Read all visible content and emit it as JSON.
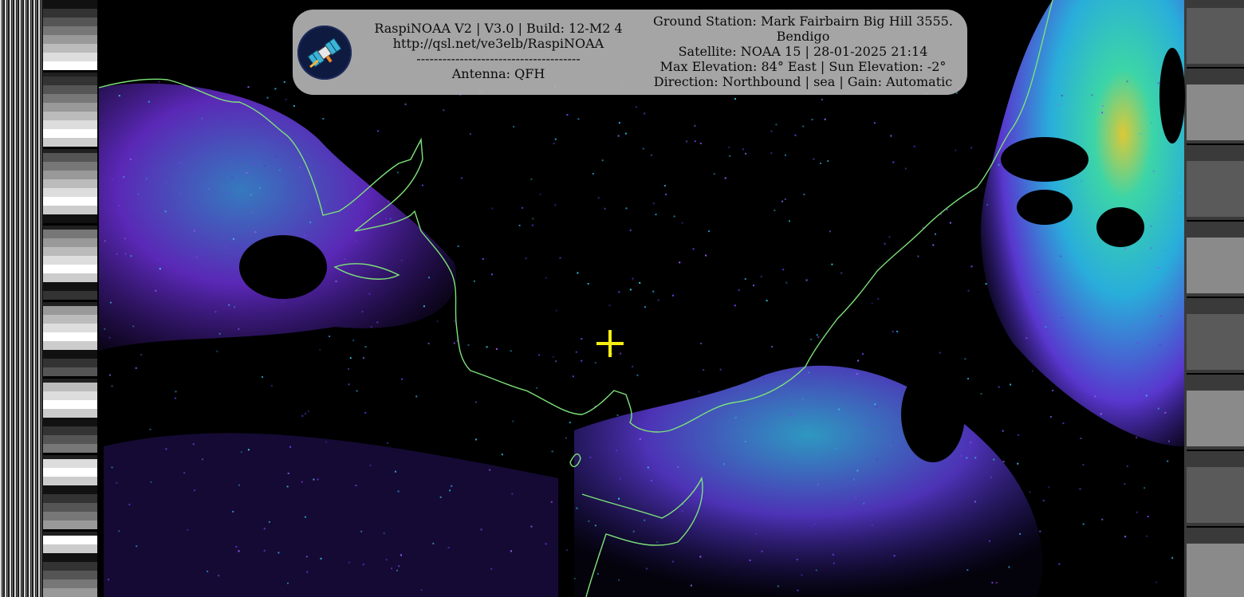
{
  "header": {
    "left_lines": [
      "RaspiNOAA V2 | V3.0 | Build: 12-M2 4",
      "http://qsl.net/ve3elb/RaspiNOAA",
      "--------------------------------------",
      "Antenna: QFH"
    ],
    "right_lines": [
      "Ground Station: Mark Fairbairn Big Hill 3555.",
      "Bendigo",
      "Satellite: NOAA 15 | 28-01-2025 21:14",
      "Max Elevation: 84° East | Sun Elevation: -2°",
      "Direction: Northbound | sea | Gain: Automatic"
    ]
  },
  "icons": {
    "logo": "satellite-icon",
    "marker": "crosshair-icon"
  },
  "colors": {
    "overlay_bg": "#b2b2b2",
    "coastline": "#7de27a",
    "crosshair": "#f5ee10",
    "cloud_low": "#6a2fd6",
    "cloud_mid": "#2bc7e0",
    "cloud_high": "#e8d33a"
  }
}
